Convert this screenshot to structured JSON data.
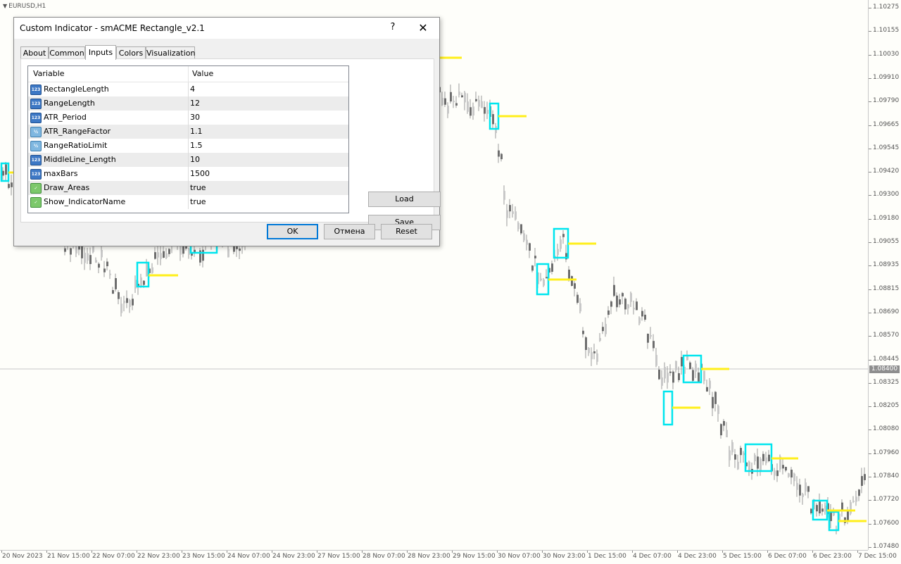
{
  "chart": {
    "symbol": "EURUSD,H1",
    "current_price": "1.08400",
    "price_ticks": [
      "1.10275",
      "1.10155",
      "1.10030",
      "1.09910",
      "1.09790",
      "1.09665",
      "1.09545",
      "1.09420",
      "1.09300",
      "1.09180",
      "1.09055",
      "1.08935",
      "1.08815",
      "1.08690",
      "1.08570",
      "1.08445",
      "1.08325",
      "1.08205",
      "1.08080",
      "1.07960",
      "1.07840",
      "1.07720",
      "1.07600",
      "1.07480"
    ],
    "time_ticks": [
      "20 Nov 2023",
      "21 Nov 15:00",
      "22 Nov 07:00",
      "22 Nov 23:00",
      "23 Nov 15:00",
      "24 Nov 07:00",
      "24 Nov 23:00",
      "27 Nov 15:00",
      "28 Nov 07:00",
      "28 Nov 23:00",
      "29 Nov 15:00",
      "30 Nov 07:00",
      "30 Nov 23:00",
      "1 Dec 15:00",
      "4 Dec 07:00",
      "4 Dec 23:00",
      "5 Dec 15:00",
      "6 Dec 07:00",
      "6 Dec 23:00",
      "7 Dec 15:00"
    ],
    "colors": {
      "background": "#fefefa",
      "bull_candle": "#c8c8c8",
      "bear_candle": "#6e6e6e",
      "rectangle": "#00e5ee",
      "middle_line": "#ffef1a",
      "price_line": "#c8c8c8"
    }
  },
  "dialog": {
    "title": "Custom Indicator - smACME Rectangle_v2.1",
    "help_label": "?",
    "close_label": "✕",
    "tabs": [
      {
        "label": "About",
        "active": false
      },
      {
        "label": "Common",
        "active": false
      },
      {
        "label": "Inputs",
        "active": true
      },
      {
        "label": "Colors",
        "active": false
      },
      {
        "label": "Visualization",
        "active": false
      }
    ],
    "grid": {
      "col_variable": "Variable",
      "col_value": "Value",
      "rows": [
        {
          "icon": "int-icon",
          "icon_text": "123",
          "name": "RectangleLength",
          "value": "4"
        },
        {
          "icon": "int-icon",
          "icon_text": "123",
          "name": "RangeLength",
          "value": "12"
        },
        {
          "icon": "int-icon",
          "icon_text": "123",
          "name": "ATR_Period",
          "value": "30"
        },
        {
          "icon": "double-icon",
          "icon_text": "½",
          "name": "ATR_RangeFactor",
          "value": "1.1"
        },
        {
          "icon": "double-icon",
          "icon_text": "½",
          "name": "RangeRatioLimit",
          "value": "1.5"
        },
        {
          "icon": "int-icon",
          "icon_text": "123",
          "name": "MiddleLine_Length",
          "value": "10"
        },
        {
          "icon": "int-icon",
          "icon_text": "123",
          "name": "maxBars",
          "value": "1500"
        },
        {
          "icon": "bool-icon",
          "icon_text": "✓",
          "name": "Draw_Areas",
          "value": "true"
        },
        {
          "icon": "bool-icon",
          "icon_text": "✓",
          "name": "Show_IndicatorName",
          "value": "true"
        }
      ]
    },
    "buttons": {
      "load": "Load",
      "save": "Save",
      "ok": "OK",
      "cancel": "Отмена",
      "reset": "Reset"
    }
  }
}
